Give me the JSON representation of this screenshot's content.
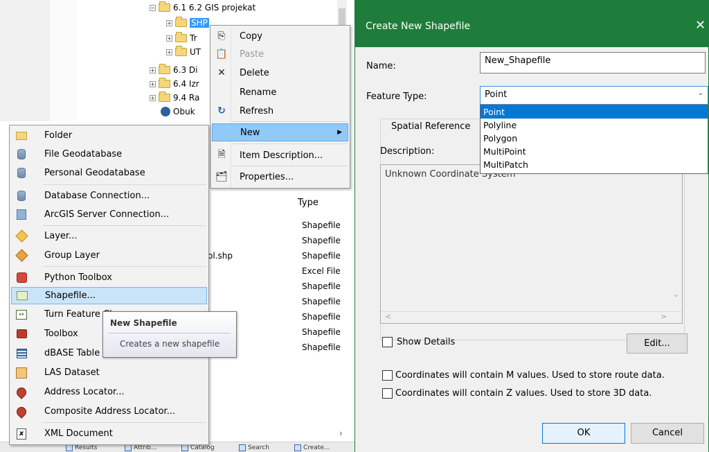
{
  "catalog": {
    "tree": [
      {
        "label": "6.1  6.2 GIS projekat",
        "indent": 1
      },
      {
        "label": "SHP",
        "indent": 2,
        "selected": true
      },
      {
        "label": "Tr",
        "indent": 2
      },
      {
        "label": "UT",
        "indent": 2
      },
      {
        "label": "6.3 Di",
        "indent": 1
      },
      {
        "label": "6.4 Izr",
        "indent": 1
      },
      {
        "label": "9.4 Ra",
        "indent": 1
      },
      {
        "label": "Obuk",
        "indent": 1
      }
    ],
    "type_header": "Type",
    "types": [
      "Shapefile",
      "Shapefile",
      "Shapefile",
      "Excel File",
      "Shapefile",
      "Shapefile",
      "Shapefile",
      "Shapefile",
      "Shapefile"
    ],
    "partial_filename": "ol.shp",
    "bottom_tabs": [
      "Results",
      "Attrib...",
      "Catalog",
      "Search",
      "Create..."
    ]
  },
  "context_menu": {
    "items": [
      {
        "label": "Copy",
        "icon": "copy-icon"
      },
      {
        "label": "Paste",
        "icon": "paste-icon",
        "disabled": true
      },
      {
        "label": "Delete",
        "icon": "delete-icon"
      },
      {
        "label": "Rename",
        "icon": ""
      },
      {
        "label": "Refresh",
        "icon": "refresh-icon"
      },
      {
        "label": "New",
        "icon": "",
        "highlight": true,
        "submenu": true
      },
      {
        "label": "Item Description...",
        "icon": "item-description-icon"
      },
      {
        "label": "Properties...",
        "icon": "properties-icon"
      }
    ]
  },
  "new_submenu": {
    "items": [
      {
        "label": "Folder",
        "icon": "folder-icon"
      },
      {
        "label": "File Geodatabase",
        "icon": "file-geodatabase-icon"
      },
      {
        "label": "Personal Geodatabase",
        "icon": "personal-geodatabase-icon"
      },
      {
        "label": "Database Connection...",
        "icon": "database-connection-icon"
      },
      {
        "label": "ArcGIS Server Connection...",
        "icon": "server-connection-icon"
      },
      {
        "label": "Layer...",
        "icon": "layer-icon"
      },
      {
        "label": "Group Layer",
        "icon": "group-layer-icon"
      },
      {
        "label": "Python Toolbox",
        "icon": "python-toolbox-icon"
      },
      {
        "label": "Shapefile...",
        "icon": "shapefile-icon",
        "highlight": true
      },
      {
        "label": "Turn Feature Class...",
        "icon": "turn-feature-icon"
      },
      {
        "label": "Toolbox",
        "icon": "toolbox-icon"
      },
      {
        "label": "dBASE Table",
        "icon": "dbase-table-icon"
      },
      {
        "label": "LAS Dataset",
        "icon": "las-dataset-icon"
      },
      {
        "label": "Address Locator...",
        "icon": "address-locator-icon"
      },
      {
        "label": "Composite Address Locator...",
        "icon": "composite-locator-icon"
      },
      {
        "label": "XML Document",
        "icon": "xml-document-icon"
      }
    ]
  },
  "tooltip": {
    "title": "New Shapefile",
    "description": "Creates a new shapefile"
  },
  "dialog": {
    "title": "Create New Shapefile",
    "name_label": "Name:",
    "name_value": "New_Shapefile",
    "feature_type_label": "Feature Type:",
    "feature_type_value": "Point",
    "feature_type_options": [
      "Point",
      "Polyline",
      "Polygon",
      "MultiPoint",
      "MultiPatch"
    ],
    "spatial_reference_label": "Spatial Reference",
    "description_label": "Description:",
    "description_value": "Unknown Coordinate System",
    "show_details_label": "Show Details",
    "edit_label": "Edit...",
    "m_values_label": "Coordinates will contain M values. Used to store route data.",
    "z_values_label": "Coordinates will contain Z values. Used to store 3D data.",
    "ok_label": "OK",
    "cancel_label": "Cancel",
    "colors": {
      "title_bar": "#1e7d3a",
      "selection": "#0078d7"
    }
  }
}
